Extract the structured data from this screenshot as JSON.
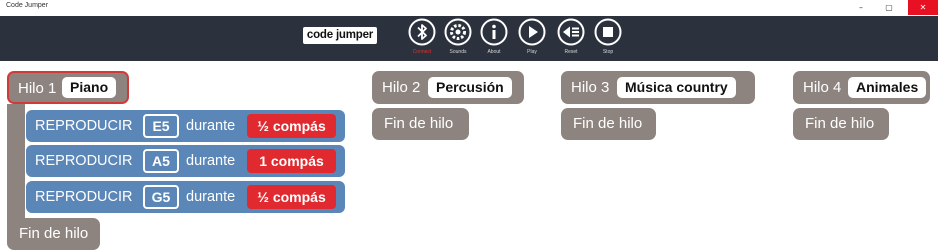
{
  "window": {
    "title": "Code Jumper",
    "minimize": "–",
    "maximize": "▢",
    "close": "✕"
  },
  "toolbar": {
    "logo": "code jumper",
    "items": [
      {
        "label": "Connect",
        "icon": "bluetooth-icon"
      },
      {
        "label": "Sounds",
        "icon": "sounds-gear-icon"
      },
      {
        "label": "About",
        "icon": "info-icon"
      },
      {
        "label": "Play",
        "icon": "play-icon"
      },
      {
        "label": "Reset",
        "icon": "reset-icon"
      },
      {
        "label": "Stop",
        "icon": "stop-icon"
      }
    ],
    "active_color": "#e03131"
  },
  "threads": [
    {
      "label": "Hilo 1",
      "name": "Piano",
      "end": "Fin de hilo",
      "blocks": [
        {
          "action": "REPRODUCIR",
          "note": "E5",
          "during": "durante",
          "length": "½ compás"
        },
        {
          "action": "REPRODUCIR",
          "note": "A5",
          "during": "durante",
          "length": "1 compás"
        },
        {
          "action": "REPRODUCIR",
          "note": "G5",
          "during": "durante",
          "length": "½ compás"
        }
      ]
    },
    {
      "label": "Hilo 2",
      "name": "Percusión",
      "end": "Fin de hilo"
    },
    {
      "label": "Hilo 3",
      "name": "Música country",
      "end": "Fin de hilo"
    },
    {
      "label": "Hilo 4",
      "name": "Animales",
      "end": "Fin de hilo"
    }
  ],
  "colors": {
    "toolbar": "#2b323d",
    "thread": "#8d8480",
    "play_block": "#5b86b8",
    "length_badge": "#e02a2f",
    "selected_border": "#d23a3a"
  }
}
